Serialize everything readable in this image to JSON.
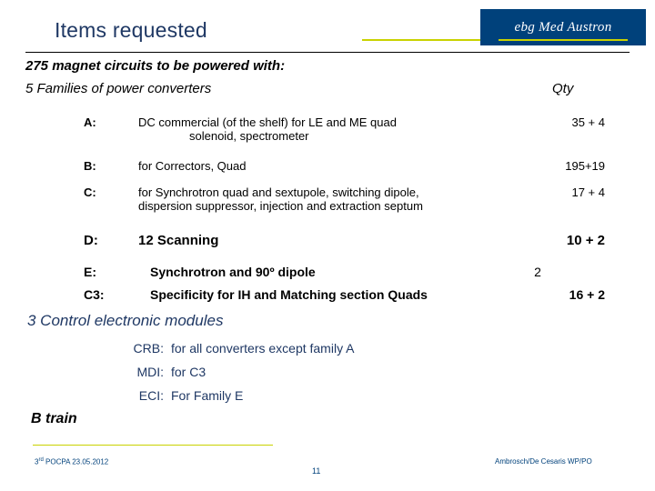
{
  "header": {
    "title": "Items requested",
    "logo_text": "ebg Med Austron",
    "accent_color": "#C9D200",
    "logo_bg": "#00417B",
    "title_color": "#1F3864"
  },
  "body": {
    "lead": "275 magnet circuits to be powered with:",
    "subhead": "5 Families of power converters",
    "qty_header": "Qty",
    "rows": [
      {
        "key": "A:",
        "desc_line1": "DC commercial (of the shelf) for LE and ME quad",
        "desc_line2": "solenoid, spectrometer",
        "qty": "35 + 4"
      },
      {
        "key": "B:",
        "desc_line1": "for Correctors, Quad",
        "desc_line2": "",
        "qty": "195+19"
      },
      {
        "key": "C:",
        "desc_line1": "for Synchrotron quad and sextupole, switching dipole,",
        "desc_line2": "dispersion  suppressor, injection and extraction septum",
        "qty": "17 + 4"
      },
      {
        "key": "D:",
        "desc_line1": "12 Scanning",
        "desc_line2": "",
        "qty": "10 + 2"
      },
      {
        "key": "E:",
        "desc_line1": "Synchrotron and 90º dipole",
        "desc_line2": "",
        "qty": "2"
      },
      {
        "key": "C3:",
        "desc_line1": "Specificity for IH and Matching section Quads",
        "desc_line2": "",
        "qty": "16 + 2"
      }
    ],
    "section2_title": "3 Control electronic modules",
    "control_modules": [
      {
        "label": "CRB:",
        "value": "for all converters except family A"
      },
      {
        "label": "MDI:",
        "value": "for C3"
      },
      {
        "label": "ECI:",
        "value": "For Family E"
      }
    ],
    "section3_title": "B train"
  },
  "footer": {
    "left_prefix": "3",
    "left_sup": "rd",
    "left_rest": " POCPA 23.05.2012",
    "page_number": "11",
    "right": "Ambrosch/De Cesaris WP/PO"
  }
}
